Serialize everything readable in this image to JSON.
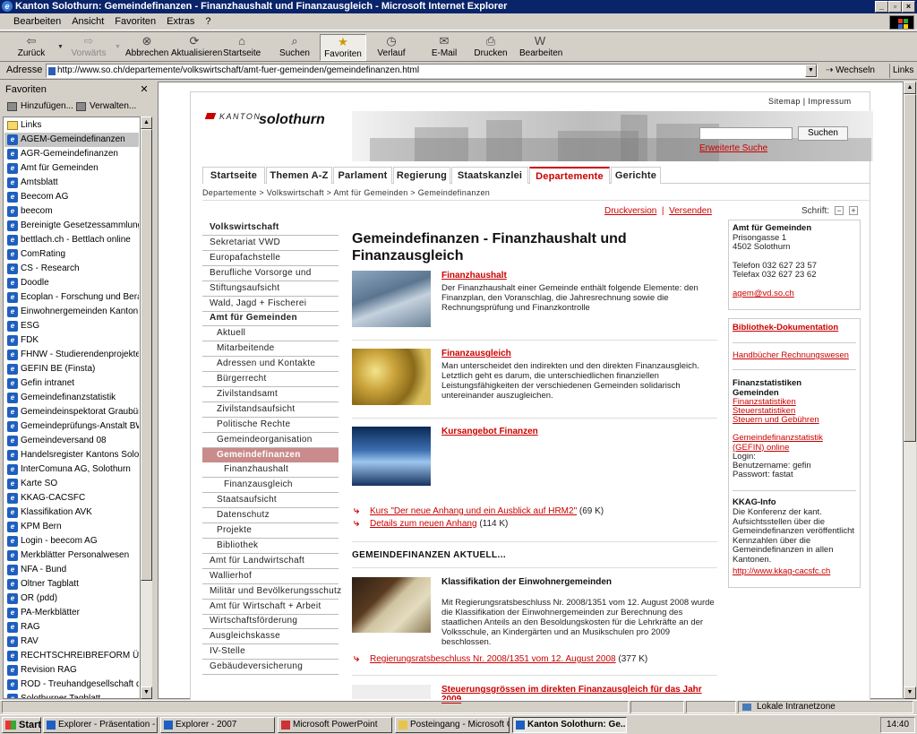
{
  "window": {
    "title": "Kanton Solothurn: Gemeindefinanzen - Finanzhaushalt und Finanzausgleich - Microsoft Internet Explorer"
  },
  "menu": [
    "Bearbeiten",
    "Ansicht",
    "Favoriten",
    "Extras",
    "?"
  ],
  "toolbar": {
    "back": "Zurück",
    "forward": "Vorwärts",
    "stop": "Abbrechen",
    "refresh": "Aktualisieren",
    "home": "Startseite",
    "search": "Suchen",
    "favorites": "Favoriten",
    "history": "Verlauf",
    "mail": "E-Mail",
    "print": "Drucken",
    "edit": "Bearbeiten"
  },
  "address": {
    "label": "Adresse",
    "url": "http://www.so.ch/departemente/volkswirtschaft/amt-fuer-gemeinden/gemeindefinanzen.html",
    "go": "Wechseln zu",
    "links": "Links"
  },
  "favorites": {
    "title": "Favoriten",
    "add": "Hinzufügen...",
    "organize": "Verwalten...",
    "selected_index": 1,
    "items": [
      "Links",
      "AGEM-Gemeindefinanzen",
      "AGR-Gemeindefinanzen",
      "Amt für Gemeinden",
      "Amtsblatt",
      "Beecom AG",
      "beecom",
      "Bereinigte Gesetzessammlung K...",
      "bettlach.ch - Bettlach online",
      "ComRating",
      "CS - Research",
      "Doodle",
      "Ecoplan - Forschung und Beratu...",
      "Einwohnergemeinden Kanton So...",
      "ESG",
      "FDK",
      "FHNW - Studierendenprojekte",
      "GEFIN BE (Finsta)",
      "Gefin intranet",
      "Gemeindefinanzstatistik",
      "Gemeindeinspektorat Graubünden",
      "Gemeindeprüfungs-Anstalt BW",
      "Gemeindeversand 08",
      "Handelsregister Kantons Solothu...",
      "InterComuna AG, Solothurn",
      "Karte SO",
      "KKAG-CACSFC",
      "Klassifikation AVK",
      "KPM Bern",
      "Login - beecom AG",
      "Merkblätter Personalwesen",
      "NFA - Bund",
      "Oltner Tagblatt",
      "OR (pdd)",
      "PA-Merkblätter",
      "RAG",
      "RAV",
      "RECHTSCHREIBREFORM Über...",
      "Revision RAG",
      "ROD - Treuhandgesellschaft des...",
      "Solothurner Tagblatt"
    ]
  },
  "site": {
    "toplinks": "Sitemap  |  Impressum",
    "logo_kanton": "KANTON",
    "logo_name": "solothurn",
    "search_button": "Suchen",
    "advanced_search": "Erweiterte Suche",
    "nav": [
      "Startseite",
      "Themen A-Z",
      "Parlament",
      "Regierung",
      "Staatskanzlei",
      "Departemente",
      "Gerichte"
    ],
    "nav_active": "Departemente",
    "breadcrumb": "Departemente > Volkswirtschaft > Amt für Gemeinden > Gemeindefinanzen",
    "print": "Druckversion",
    "send": "Versenden",
    "font_label": "Schrift:",
    "font_minus": "−",
    "font_plus": "+",
    "leftnav": [
      {
        "label": "Volkswirtschaft",
        "cls": "h"
      },
      {
        "label": "Sekretariat VWD",
        "cls": ""
      },
      {
        "label": "Europafachstelle",
        "cls": ""
      },
      {
        "label": "Berufliche Vorsorge und",
        "cls": ""
      },
      {
        "label": "Stiftungsaufsicht",
        "cls": ""
      },
      {
        "label": "Wald, Jagd + Fischerei",
        "cls": ""
      },
      {
        "label": "Amt für Gemeinden",
        "cls": "h"
      },
      {
        "label": "Aktuell",
        "cls": "l2"
      },
      {
        "label": "Mitarbeitende",
        "cls": "l2"
      },
      {
        "label": "Adressen und Kontakte",
        "cls": "l2"
      },
      {
        "label": "Bürgerrecht",
        "cls": "l2"
      },
      {
        "label": "Zivilstandsamt",
        "cls": "l2"
      },
      {
        "label": "Zivilstandsaufsicht",
        "cls": "l2"
      },
      {
        "label": "Politische Rechte",
        "cls": "l2"
      },
      {
        "label": "Gemeindeorganisation",
        "cls": "l2"
      },
      {
        "label": "Gemeindefinanzen",
        "cls": "l2 on"
      },
      {
        "label": "Finanzhaushalt",
        "cls": "l3"
      },
      {
        "label": "Finanzausgleich",
        "cls": "l3"
      },
      {
        "label": "Staatsaufsicht",
        "cls": "l2"
      },
      {
        "label": "Datenschutz",
        "cls": "l2"
      },
      {
        "label": "Projekte",
        "cls": "l2"
      },
      {
        "label": "Bibliothek",
        "cls": "l2"
      },
      {
        "label": "Amt für Landwirtschaft",
        "cls": ""
      },
      {
        "label": "Wallierhof",
        "cls": ""
      },
      {
        "label": "Militär und Bevölkerungsschutz",
        "cls": ""
      },
      {
        "label": "Amt für Wirtschaft + Arbeit",
        "cls": ""
      },
      {
        "label": "Wirtschaftsförderung",
        "cls": ""
      },
      {
        "label": "Ausgleichskasse",
        "cls": ""
      },
      {
        "label": "IV-Stelle",
        "cls": ""
      },
      {
        "label": "Gebäudeversicherung",
        "cls": ""
      }
    ],
    "h1": "Gemeindefinanzen - Finanzhaushalt und Finanzausgleich",
    "sections": [
      {
        "title": "Finanzhaushalt",
        "text": "Der Finanzhaushalt einer Gemeinde enthält folgende Elemente: den Finanzplan, den Voranschlag, die Jahresrechnung sowie die Rechnungsprüfung und Finanzkontrolle"
      },
      {
        "title": "Finanzausgleich",
        "text": "Man unterscheidet den indirekten und den direkten Finanzausgleich. Letztlich geht es darum, die unterschiedlichen finanziellen Leistungsfähigkeiten der verschiedenen Gemeinden solidarisch untereinander auszugleichen."
      },
      {
        "title": "Kursangebot Finanzen",
        "text": ""
      }
    ],
    "downloads": [
      {
        "link": "Kurs \"Der neue Anhang und ein Ausblick auf HRM2\"",
        "size": "(69 K)"
      },
      {
        "link": "Details zum neuen Anhang",
        "size": "(114 K)"
      }
    ],
    "aktuell_title": "GEMEINDEFINANZEN AKTUELL...",
    "news1": {
      "title": "Klassifikation der Einwohnergemeinden",
      "text": "Mit Regierungsratsbeschluss Nr. 2008/1351 vom 12. August 2008 wurde die Klassifikation der Einwohnergemeinden zur Berechnung des staatlichen Anteils an den Besoldungskosten für die Lehrkräfte an der Volksschule, an Kindergärten und an Musikschulen pro 2009 beschlossen.",
      "link": "Regierungsratsbeschluss Nr. 2008/1351 vom 12. August 2008",
      "size": "(377 K)"
    },
    "news2": {
      "title": "Steuerungsgrössen im direkten Finanzausgleich für das Jahr 2009"
    },
    "right": {
      "contact_title": "Amt für Gemeinden",
      "contact_lines": [
        "Prisongasse 1",
        "4502 Solothurn",
        "",
        "Telefon 032 627 23 57",
        "Telefax 032 627 23 62"
      ],
      "email": "agem@vd.so.ch",
      "bib": "Bibliothek-Dokumentation",
      "handbooks": "Handbücher Rechnungswesen",
      "stats_title": "Finanzstatistiken Gemeinden",
      "stats_links": [
        "Finanzstatistiken",
        "Steuerstatistiken",
        "Steuern und Gebühren"
      ],
      "gefin": "Gemeindefinanzstatistik (GEFIN) online",
      "login_lines": [
        "Login:",
        "Benutzername: gefin",
        "Passwort: fastat"
      ],
      "kkag_title": "KKAG-Info",
      "kkag_text": "Die Konferenz der kant. Aufsichtsstellen über die Gemeindefinanzen veröffentlicht Kennzahlen über die Gemeindefinanzen in allen Kantonen.",
      "kkag_link": "http://www.kkag-cacsfc.ch"
    }
  },
  "status": {
    "zone": "Lokale Intranetzone"
  },
  "taskbar": {
    "start": "Start",
    "tasks": [
      "Explorer - Präsentation - Fi...",
      "Explorer - 2007",
      "Microsoft PowerPoint",
      "Posteingang - Microsoft O...",
      "Kanton Solothurn: Ge..."
    ],
    "clock": "14:40"
  }
}
